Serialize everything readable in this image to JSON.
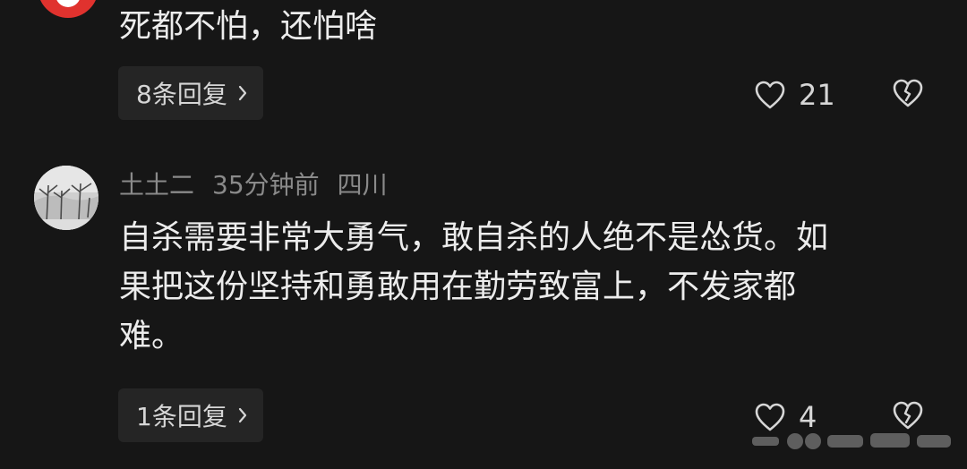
{
  "comments": [
    {
      "text": "死都不怕，还怕啥",
      "reply_label": "8条回复",
      "like_count": "21"
    },
    {
      "username": "土土二",
      "time": "35分钟前",
      "location": "四川",
      "text_lines": [
        "自杀需要非常大勇气，敢自杀的人绝不是怂货。如",
        "果把这份坚持和勇敢用在勤劳致富上，不发家都",
        "难。"
      ],
      "reply_label": "1条回复",
      "like_count": "4"
    }
  ],
  "colors": {
    "background": "#161616",
    "pill": "#252525",
    "meta_text": "#8a8a8a",
    "avatar_red": "#e0322e"
  },
  "icons": [
    "heart-outline-icon",
    "broken-heart-icon",
    "chevron-right-icon"
  ]
}
